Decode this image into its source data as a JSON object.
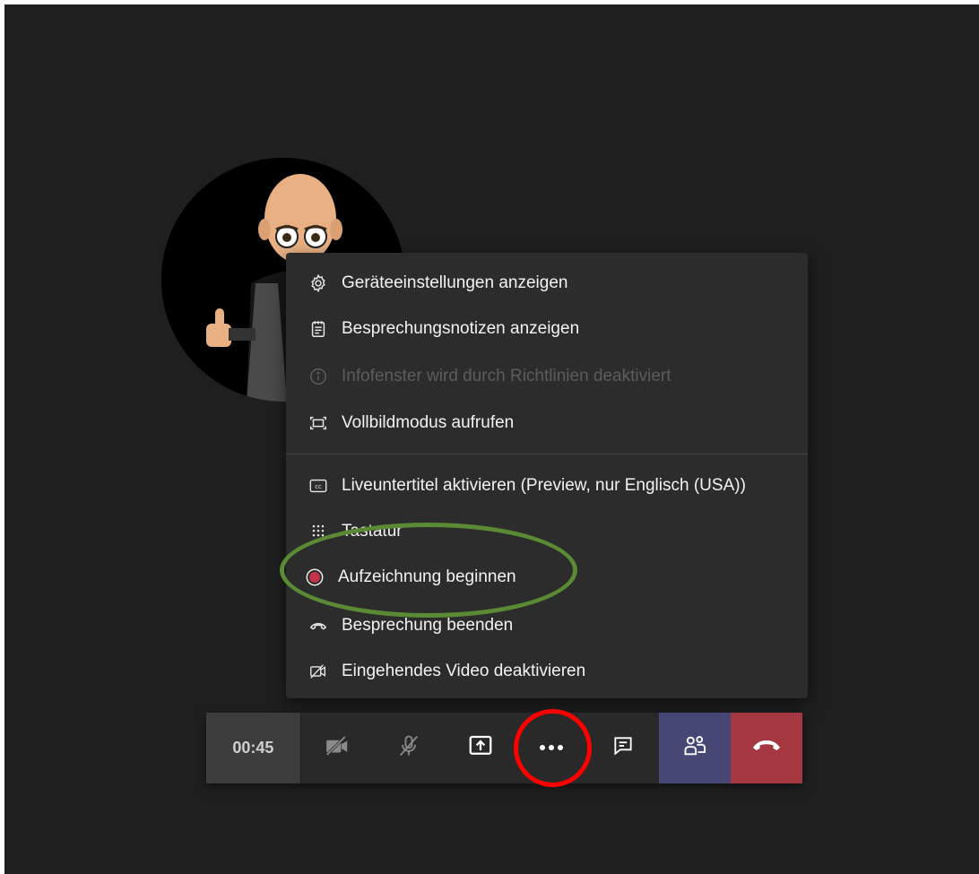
{
  "menu": {
    "items": [
      {
        "label": "Geräteeinstellungen anzeigen",
        "icon": "gear-icon",
        "enabled": true
      },
      {
        "label": "Besprechungsnotizen anzeigen",
        "icon": "notes-icon",
        "enabled": true
      },
      {
        "label": "Infofenster wird durch Richtlinien deaktiviert",
        "icon": "info-icon",
        "enabled": false
      },
      {
        "label": "Vollbildmodus aufrufen",
        "icon": "fullscreen-icon",
        "enabled": true
      },
      {
        "label": "Liveuntertitel aktivieren (Preview, nur Englisch (USA))",
        "icon": "closed-captions-icon",
        "enabled": true
      },
      {
        "label": "Tastatur",
        "icon": "dialpad-icon",
        "enabled": true
      },
      {
        "label": "Aufzeichnung beginnen",
        "icon": "record-icon",
        "enabled": true
      },
      {
        "label": "Besprechung beenden",
        "icon": "end-call-icon",
        "enabled": true
      },
      {
        "label": "Eingehendes Video deaktivieren",
        "icon": "video-off-icon",
        "enabled": true
      }
    ]
  },
  "callbar": {
    "timer": "00:45",
    "buttons": [
      "camera-off-icon",
      "mic-off-icon",
      "share-screen-icon",
      "more-options-icon",
      "chat-icon",
      "participants-icon",
      "hang-up-icon"
    ]
  },
  "colors": {
    "record": "#c4314b",
    "hangup": "#a4373f",
    "participants": "#464775",
    "annotation_green": "#5a8a34",
    "annotation_red": "#ff0000"
  }
}
